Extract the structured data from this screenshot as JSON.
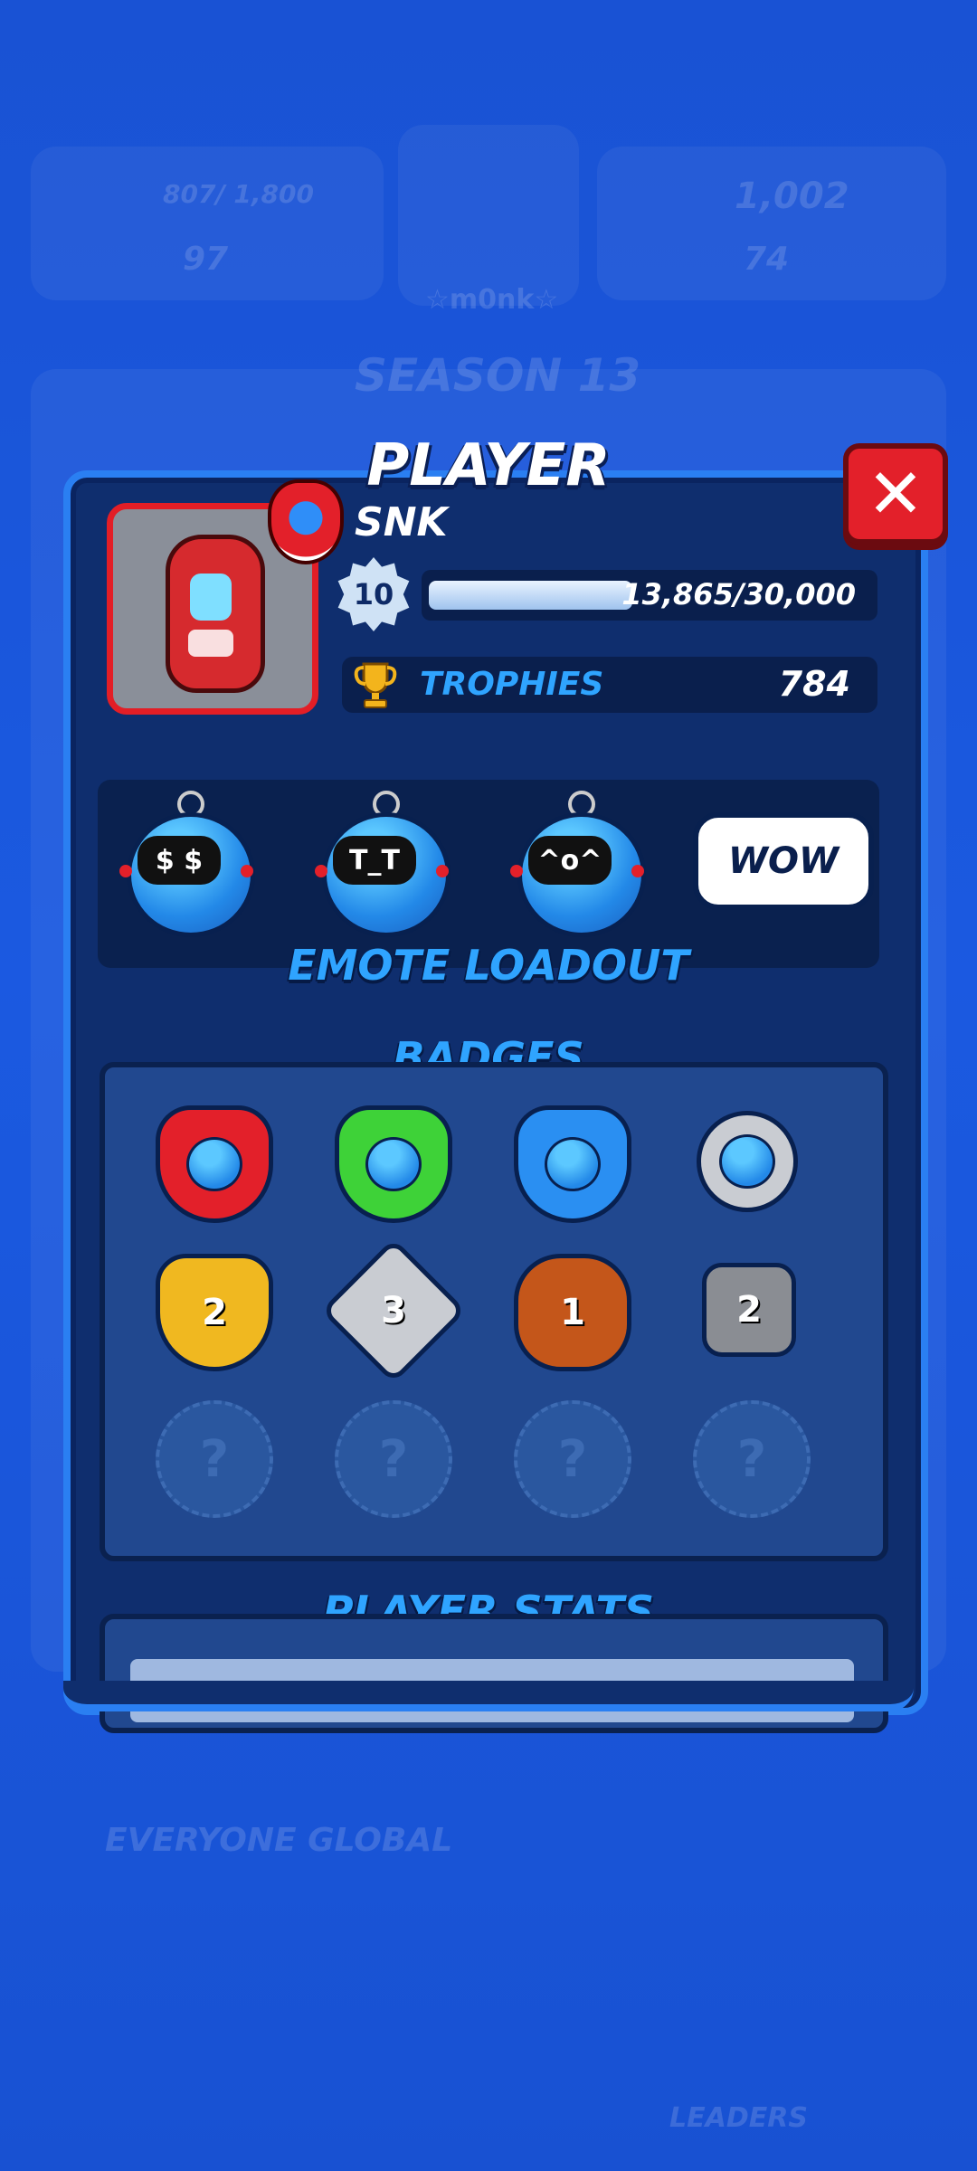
{
  "background": {
    "coins": "807/ 1,800",
    "gems": "97",
    "trophies": "1,002",
    "tokens": "74",
    "profile_name": "☆m0nk☆",
    "season": "SEASON 13",
    "leaderboard_label": "EVERYONE GLOBAL",
    "leaders_label": "LEADERS"
  },
  "modal": {
    "title": "PLAYER",
    "close_icon": "close-x-icon",
    "player_name": "SNK",
    "level": "10",
    "xp_text": "13,865/30,000",
    "xp_fraction": 0.462,
    "trophies_label": "TROPHIES",
    "trophies_value": "784",
    "emote_section_title": "EMOTE LOADOUT",
    "emotes": [
      {
        "icon": "robot-sunglasses-emote-icon",
        "face": "$ $"
      },
      {
        "icon": "robot-crying-emote-icon",
        "face": "T_T"
      },
      {
        "icon": "robot-laughing-emote-icon",
        "face": "^o^"
      }
    ],
    "wow_label": "WOW",
    "badges_title": "BADGES",
    "badges_row1": [
      {
        "icon": "red-shield-badge-icon",
        "color": "#e3202a"
      },
      {
        "icon": "green-shield-badge-icon",
        "color": "#3ed238"
      },
      {
        "icon": "blue-shield-badge-icon",
        "color": "#2a8ff2"
      },
      {
        "icon": "silver-circle-badge-icon",
        "color": "#c9ccd2"
      }
    ],
    "badges_row2": [
      {
        "num": "2",
        "color": "#f0b820"
      },
      {
        "num": "3",
        "color": "#c9ccd2"
      },
      {
        "num": "1",
        "color": "#c4561a"
      },
      {
        "num": "2",
        "color": "#8a8d93"
      }
    ],
    "locked_badge_symbol": "?",
    "stats_title": "PLAYER STATS"
  }
}
